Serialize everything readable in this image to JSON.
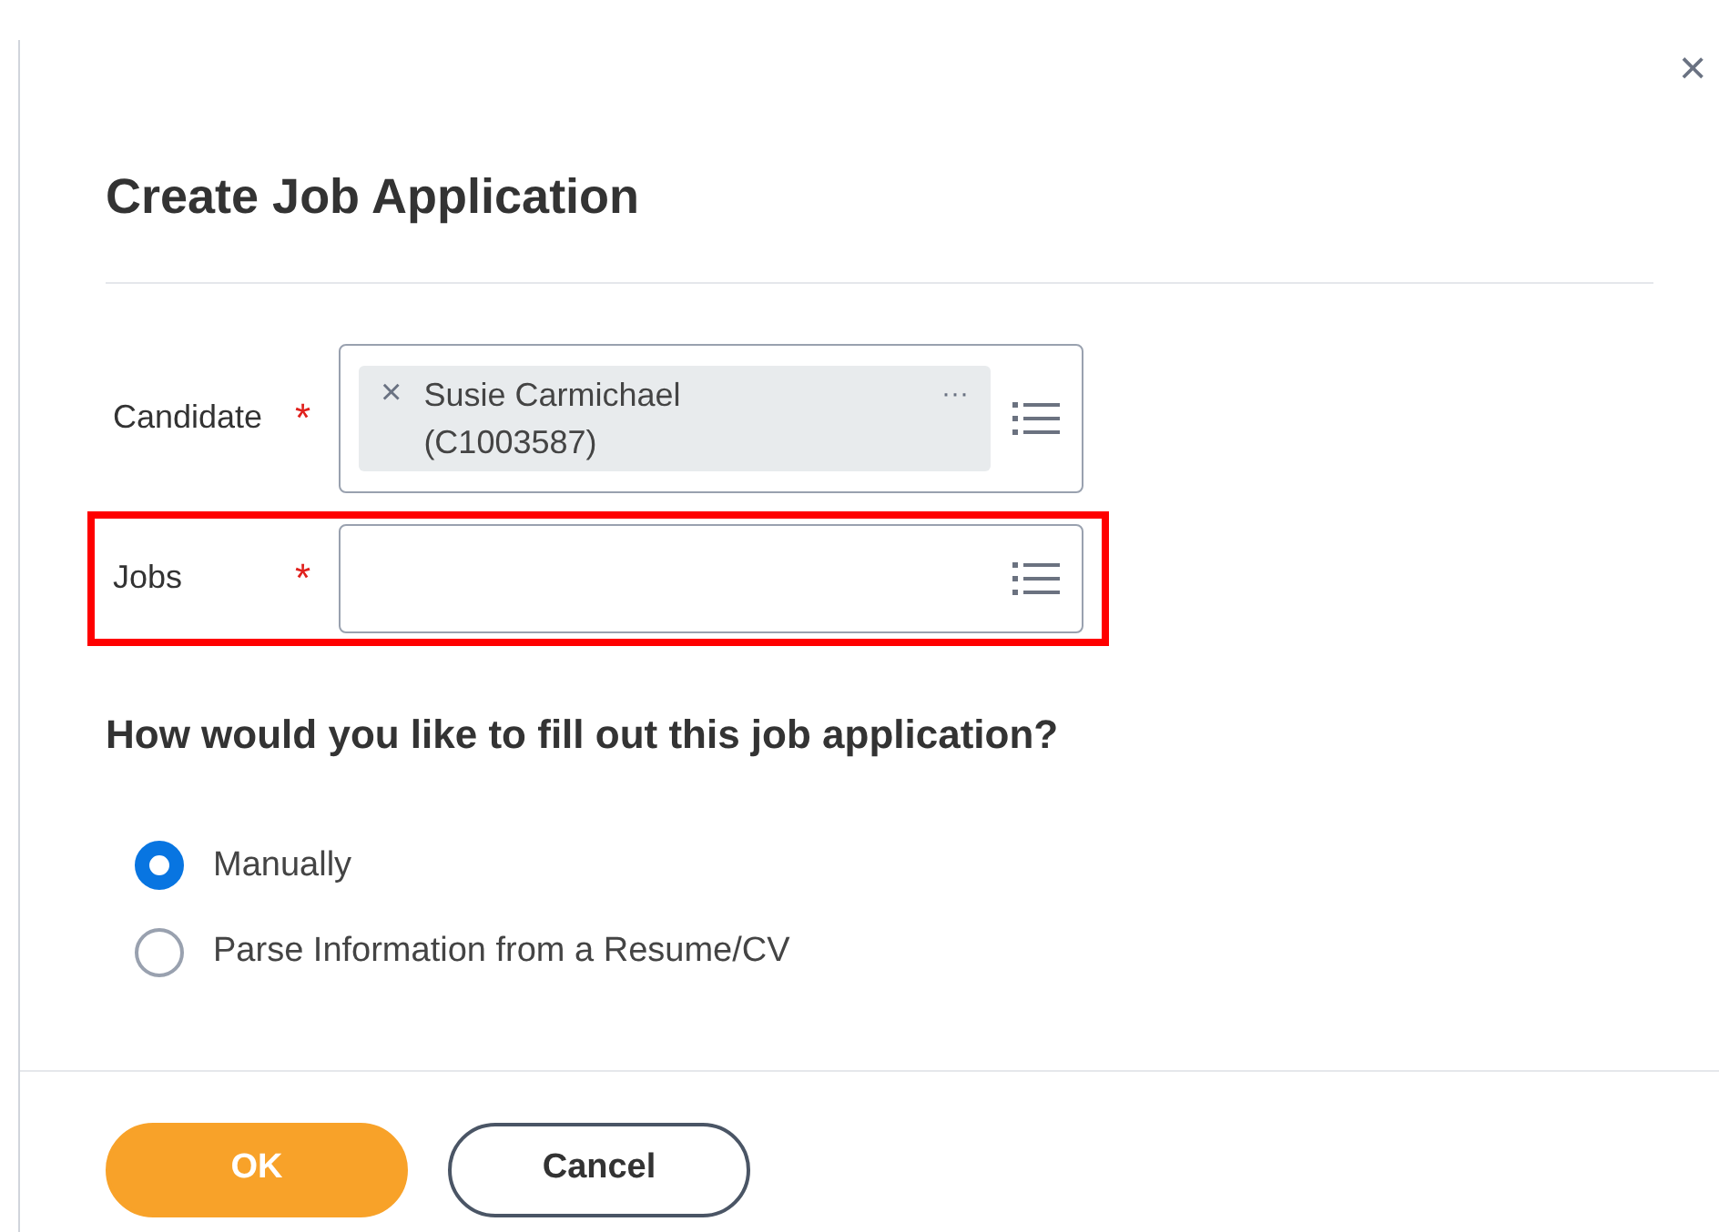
{
  "dialog": {
    "title": "Create Job Application",
    "close": "×"
  },
  "fields": [
    {
      "label": "Candidate",
      "required_mark": "*",
      "highlighted": false,
      "chips": [
        {
          "remove": "×",
          "text": "Susie Carmichael (C1003587)",
          "more": "···"
        }
      ]
    },
    {
      "label": "Jobs",
      "required_mark": "*",
      "highlighted": true
    }
  ],
  "question": "How would you like to fill out this job application?",
  "options": [
    {
      "label": "Manually",
      "selected": true
    },
    {
      "label": "Parse Information from a Resume/CV",
      "selected": false
    }
  ],
  "buttons": [
    {
      "label": "OK",
      "kind": "primary"
    },
    {
      "label": "Cancel",
      "kind": "secondary"
    }
  ]
}
